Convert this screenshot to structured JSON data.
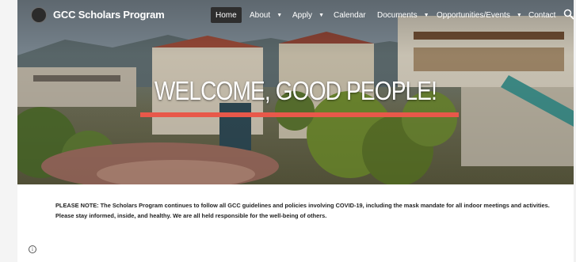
{
  "site": {
    "title": "GCC Scholars Program"
  },
  "nav": {
    "items": [
      {
        "label": "Home",
        "active": true,
        "dropdown": false
      },
      {
        "label": "About",
        "active": false,
        "dropdown": true
      },
      {
        "label": "Apply",
        "active": false,
        "dropdown": true
      },
      {
        "label": "Calendar",
        "active": false,
        "dropdown": false
      },
      {
        "label": "Documents",
        "active": false,
        "dropdown": true
      },
      {
        "label": "Opportunities/Events",
        "active": false,
        "dropdown": true
      },
      {
        "label": "Contact",
        "active": false,
        "dropdown": false
      }
    ],
    "search_icon": "search-icon"
  },
  "hero": {
    "title": "WELCOME, GOOD PEOPLE!",
    "underline_color": "#e8584a"
  },
  "notice": {
    "text": "PLEASE NOTE: The Scholars Program continues to follow all GCC guidelines and policies involving COVID-19, including the mask mandate for all indoor meetings and activities. Please stay informed, inside, and healthy. We are all held responsible for the well-being of others."
  },
  "footer": {
    "info_icon": "info-icon",
    "info_glyph": "i"
  }
}
